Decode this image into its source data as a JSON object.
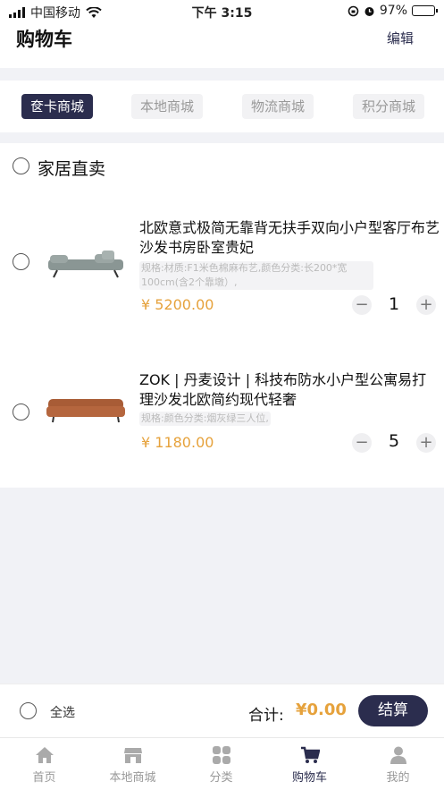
{
  "status_bar": {
    "carrier": "中国移动",
    "time": "下午 3:15",
    "battery": "97%",
    "battery_level": 0.97
  },
  "header": {
    "title": "购物车",
    "edit_label": "编辑"
  },
  "tabs": [
    {
      "label": "奁卡商城",
      "active": true
    },
    {
      "label": "本地商城",
      "active": false
    },
    {
      "label": "物流商城",
      "active": false
    },
    {
      "label": "积分商城",
      "active": false
    }
  ],
  "store": {
    "name": "家居直卖"
  },
  "items": [
    {
      "name": "北欧意式极简无靠背无扶手双向小户型客厅布艺沙发书房卧室贵妃",
      "spec": "规格:材质:F1米色棉麻布艺,颜色分类:长200*宽100cm(含2个靠墩）,",
      "price": "¥ 5200.00",
      "quantity": "1",
      "color": "#8a9694"
    },
    {
      "name": "ZOK | 丹麦设计 | 科技布防水小户型公寓易打理沙发北欧简约现代轻奢",
      "spec": "规格:颜色分类:烟灰绿三人位,",
      "price": "¥ 1180.00",
      "quantity": "5",
      "color": "#b5663e"
    }
  ],
  "footer": {
    "select_all": "全选",
    "total_label": "合计:",
    "total": "¥0.00",
    "checkout": "结算"
  },
  "tabbar": [
    {
      "label": "首页",
      "icon": "home-icon",
      "active": false
    },
    {
      "label": "本地商城",
      "icon": "store-icon",
      "active": false
    },
    {
      "label": "分类",
      "icon": "grid-icon",
      "active": false
    },
    {
      "label": "购物车",
      "icon": "cart-icon",
      "active": true
    },
    {
      "label": "我的",
      "icon": "user-icon",
      "active": false
    }
  ],
  "colors": {
    "accent": "#2b2d4e",
    "price": "#e6a23c",
    "battery": "#3cc93c"
  }
}
